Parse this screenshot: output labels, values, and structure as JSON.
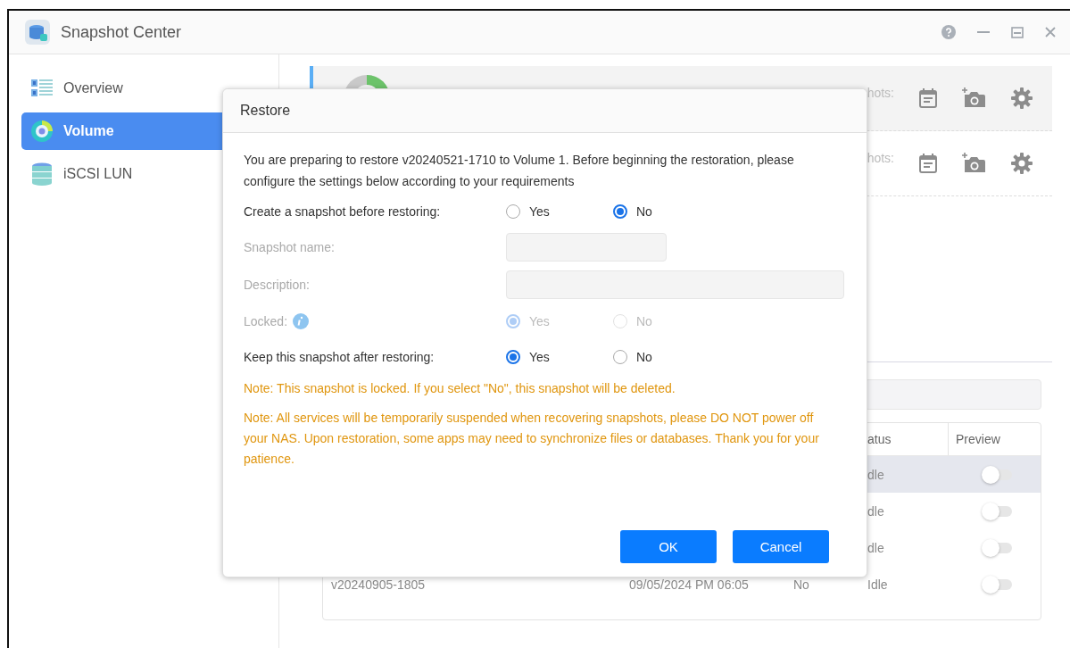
{
  "window": {
    "title": "Snapshot Center"
  },
  "sidebar": {
    "items": [
      {
        "label": "Overview",
        "selected": false,
        "kind": "list"
      },
      {
        "label": "Volume",
        "selected": true,
        "kind": "donut"
      },
      {
        "label": "iSCSI LUN",
        "selected": false,
        "kind": "stack"
      }
    ]
  },
  "volumes": [
    {
      "label": "hots:",
      "selected": true
    },
    {
      "label": "hots:",
      "selected": false
    }
  ],
  "table": {
    "columns": [
      "atus",
      "Preview"
    ],
    "rows": [
      {
        "status": "dle",
        "selected": true,
        "preview_on": false
      },
      {
        "status": "dle",
        "selected": false,
        "preview_on": false
      },
      {
        "status": "dle",
        "selected": false,
        "preview_on": false
      },
      {
        "name": "v20240905-1805",
        "date": "09/05/2024 PM 06:05",
        "locked": "No",
        "status": "Idle",
        "selected": false,
        "preview_on": false
      }
    ]
  },
  "dialog": {
    "title": "Restore",
    "message": "You are preparing to restore v20240521-1710 to Volume 1. Before beginning the restoration, please configure the settings below according to your requirements",
    "fields": [
      {
        "kind": "radio",
        "label": "Create a snapshot before restoring:",
        "disabled": false,
        "info": false,
        "options": [
          {
            "label": "Yes",
            "selected": false
          },
          {
            "label": "No",
            "selected": true
          }
        ]
      },
      {
        "kind": "text",
        "label": "Snapshot name:",
        "disabled": true,
        "info": false
      },
      {
        "kind": "text",
        "label": "Description:",
        "disabled": true,
        "info": false
      },
      {
        "kind": "radio",
        "label": "Locked:",
        "disabled": true,
        "info": true,
        "options": [
          {
            "label": "Yes",
            "selected": true
          },
          {
            "label": "No",
            "selected": false
          }
        ]
      },
      {
        "kind": "radio",
        "label": "Keep this snapshot after restoring:",
        "disabled": false,
        "info": false,
        "options": [
          {
            "label": "Yes",
            "selected": true
          },
          {
            "label": "No",
            "selected": false
          }
        ]
      }
    ],
    "notes": [
      "Note: This snapshot is locked. If you select \"No\", this snapshot will be deleted.",
      "Note: All services will be temporarily suspended when recovering snapshots, please DO NOT power off your NAS. Upon restoration, some apps may need to synchronize files or databases. Thank you for your patience."
    ],
    "buttons": [
      "OK",
      "Cancel"
    ]
  }
}
